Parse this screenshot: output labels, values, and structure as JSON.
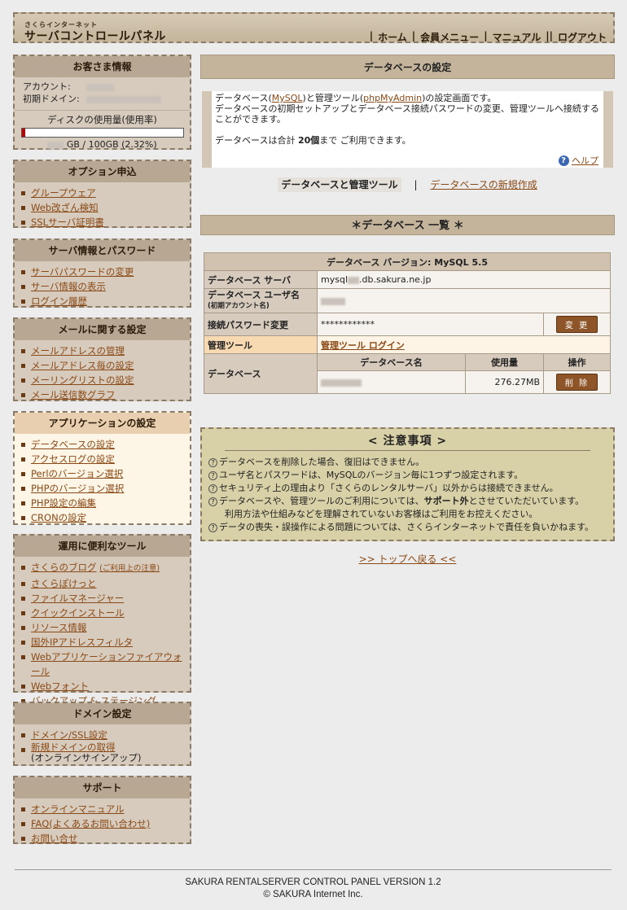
{
  "header": {
    "logo_small": "さくらインターネット",
    "logo_big": "サーバコントロールパネル",
    "nav": [
      "ホーム",
      "会員メニュー",
      "マニュアル",
      "ログアウト"
    ]
  },
  "sidebar": {
    "customer": {
      "title": "お客さま情報",
      "account_label": "アカウント:",
      "domain_label": "初期ドメイン:",
      "disk_title": "ディスクの使用量(使用率)",
      "disk_percent": 2.32,
      "disk_usage_text": "GB / 100GB (2.32%)"
    },
    "options": {
      "title": "オプション申込",
      "items": [
        "グループウェア",
        "Web改ざん検知",
        "SSLサーバ証明書"
      ]
    },
    "server": {
      "title": "サーバ情報とパスワード",
      "items": [
        "サーバパスワードの変更",
        "サーバ情報の表示",
        "ログイン履歴"
      ]
    },
    "mail": {
      "title": "メールに関する設定",
      "items": [
        "メールアドレスの管理",
        "メールアドレス毎の設定",
        "メーリングリストの設定",
        "メール送信数グラフ"
      ]
    },
    "app": {
      "title": "アプリケーションの設定",
      "items": [
        "データベースの設定",
        "アクセスログの設定",
        "Perlのバージョン選択",
        "PHPのバージョン選択",
        "PHP設定の編集",
        "CRONの設定"
      ]
    },
    "tools": {
      "title": "運用に便利なツール",
      "blog": "さくらのブログ",
      "blog_note": "(ご利用上の注意)",
      "items": [
        "さくらぽけっと",
        "ファイルマネージャー",
        "クイックインストール",
        "リソース情報",
        "国外IPアドレスフィルタ",
        "Webアプリケーションファイアウォール",
        "Webフォント",
        "バックアップ & ステージング"
      ]
    },
    "domain": {
      "title": "ドメイン設定",
      "item1": "ドメイン/SSL設定",
      "item2": "新規ドメインの取得",
      "item2_sub": "(オンラインサインアップ)"
    },
    "support": {
      "title": "サポート",
      "items": [
        "オンラインマニュアル",
        "FAQ(よくあるお問い合わせ)",
        "お問い合せ"
      ]
    }
  },
  "main": {
    "title": "データベースの設定",
    "intro_pre": "データベース(",
    "intro_mysql": "MySQL",
    "intro_mid": ")と管理ツール(",
    "intro_pma": "phpMyAdmin",
    "intro_post": ")の設定画面です。",
    "intro_line2": "データベースの初期セットアップとデータベース接続パスワードの変更、管理ツールへ接続することができます。",
    "intro_limit_pre": "データベースは合計",
    "intro_limit_num": "20個",
    "intro_limit_post": "まで ご利用できます。",
    "help": "ヘルプ",
    "subnav_current": "データベースと管理ツール",
    "subnav_new": "データベースの新規作成",
    "list_title": "＊データベース 一覧 ＊",
    "table": {
      "version": "データベース バージョン: MySQL 5.5",
      "server_label": "データベース サーバ",
      "server_pre": "mysql",
      "server_post": ".db.sakura.ne.jp",
      "user_label": "データベース ユーザ名",
      "user_sub": "(初期アカウント名)",
      "pw_label": "接続パスワード変更",
      "pw_value": "************",
      "change_btn": "変 更",
      "tool_label": "管理ツール",
      "tool_link": "管理ツール ログイン",
      "db_label": "データベース",
      "col_name": "データベース名",
      "col_usage": "使用量",
      "col_op": "操作",
      "db_usage": "276.27MB",
      "delete_btn": "削 除"
    },
    "notes": {
      "title": "< 注意事項 >",
      "n1": "データベースを削除した場合、復旧はできません。",
      "n2": "ユーザ名とパスワードは、MySQLのバージョン毎に1つずつ設定されます。",
      "n3": "セキュリティ上の理由より「さくらのレンタルサーバ」以外からは接続できません。",
      "n4_pre": "データベースや、管理ツールのご利用については、",
      "n4_bold": "サポート外",
      "n4_post": "とさせていただいています。",
      "n4_line2": "利用方法や仕組みなどを理解されていないお客様はご利用をお控えください。",
      "n5": "データの喪失・誤操作による問題については、さくらインターネットで責任を負いかねます。"
    },
    "back_top": ">> トップへ戻る <<"
  },
  "footer": {
    "line1": "SAKURA RENTALSERVER CONTROL PANEL VERSION 1.2",
    "line2": "© SAKURA Internet Inc."
  }
}
